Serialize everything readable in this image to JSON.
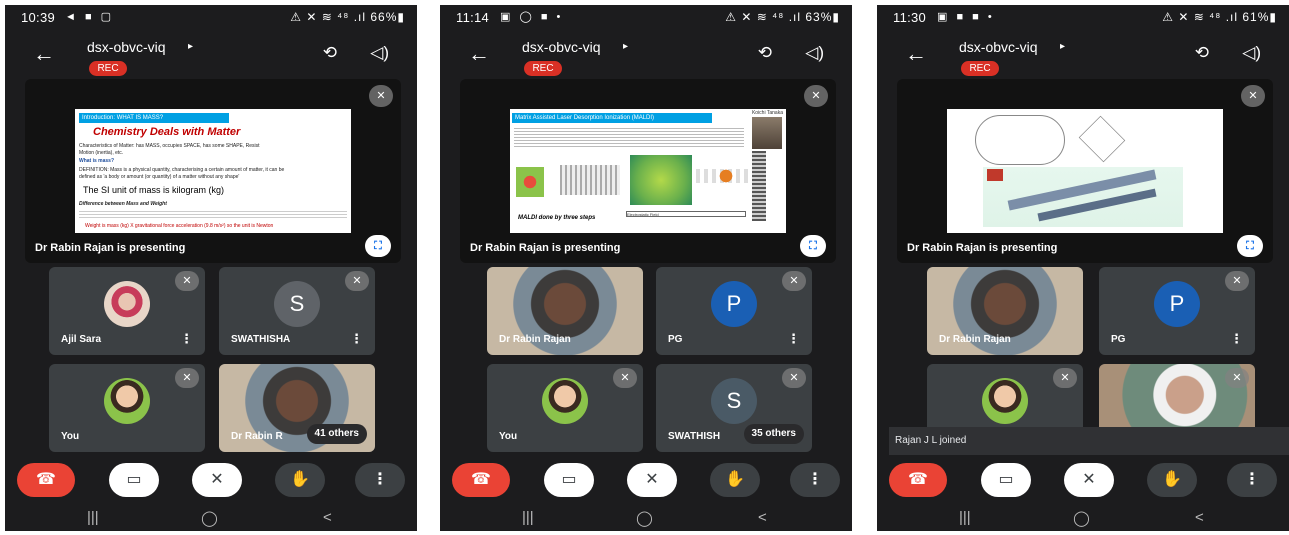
{
  "meeting": {
    "code": "dsx-obvc-viq",
    "rec_label": "REC",
    "presenter_label": "Dr Rabin Rajan is presenting"
  },
  "phones": [
    {
      "status": {
        "time": "10:39",
        "notifications": "◄ ■ ▢",
        "right": "⚠ ✕ ≋ ⁴⁸ .ıl 66%▮"
      },
      "tiles": [
        {
          "name": "Ajil Sara",
          "avatar": ""
        },
        {
          "name": "SWATHISHA",
          "avatar": "S",
          "avatar_color": "#5f6368"
        },
        {
          "name": "You",
          "avatar": ""
        },
        {
          "name": "Dr Rabin R",
          "others": "41 others"
        }
      ]
    },
    {
      "status": {
        "time": "11:14",
        "notifications": "▣ ◯ ■ •",
        "right": "⚠ ✕ ≋ ⁴⁸ .ıl 63%▮"
      },
      "tiles": [
        {
          "name": "Dr Rabin Rajan"
        },
        {
          "name": "PG",
          "avatar": "P",
          "avatar_color": "#1a5fb4"
        },
        {
          "name": "You",
          "avatar": ""
        },
        {
          "name": "SWATHISH",
          "avatar": "S",
          "avatar_color": "#4a5a66",
          "others": "35 others"
        }
      ]
    },
    {
      "status": {
        "time": "11:30",
        "notifications": "▣ ■ ■ •",
        "right": "⚠ ✕ ≋ ⁴⁸ .ıl 61%▮"
      },
      "tiles": [
        {
          "name": "Dr Rabin Rajan"
        },
        {
          "name": "PG",
          "avatar": "P",
          "avatar_color": "#1a5fb4"
        },
        {
          "name": ""
        },
        {
          "name": ""
        }
      ],
      "toast": "Rajan J L joined"
    }
  ],
  "slides": {
    "s1": {
      "title": "Introduction: WHAT IS MASS?",
      "heading": "Chemistry Deals with Matter",
      "line1": "Characteristics of Matter: has MASS, occupies SPACE, has some SHAPE, Resist",
      "line2": "Motion (inertia), etc.",
      "line3": "What is mass?",
      "line4": "DEFINITION: Mass is a physical quantity, characterising a certain amount of matter, it can be",
      "line5": "defined as 'a body or amount (or quantity) of a matter without any shape'",
      "big": "The SI unit of mass is kilogram (kg)",
      "line6": "Difference between Mass and Weight",
      "red": "Weight is mass (kg) X gravitational force acceleration (9.8 m/s²) so the unit is Newton"
    },
    "s2": {
      "title": "Matrix Assisted Laser Desorption Ionization (MALDI)",
      "author": "Koichi Tanaka",
      "caption": "MALDI done by three steps",
      "field": "Electrostatic Field"
    }
  },
  "icons": {
    "back": "←",
    "caret": "▸",
    "cam_switch": "⟲",
    "speaker": "◁)",
    "mic_off": "✕",
    "fullscreen": "⛶",
    "dots": "⋮",
    "end_call": "☎",
    "cam_off": "▭",
    "mic": "✕",
    "hand": "✋",
    "more": "⋮",
    "nav_recent": "|||",
    "nav_home": "◯",
    "nav_back": "<"
  },
  "colors": {
    "accent_red": "#ea4335",
    "rec_red": "#d93025",
    "blue": "#1a73e8",
    "dark_bg": "#1c1c1e",
    "tile_bg": "#3c4043"
  }
}
